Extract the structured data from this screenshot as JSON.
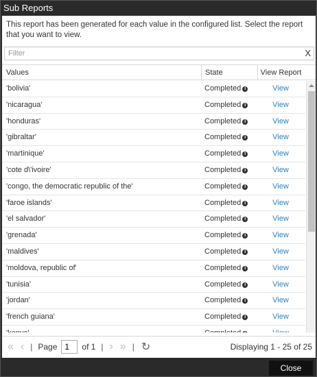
{
  "window": {
    "title": "Sub Reports"
  },
  "description": "This report has been generated for each value in the configured list. Select the report that you want to view.",
  "filter": {
    "placeholder": "Filter",
    "value": "",
    "clear_glyph": "X"
  },
  "table": {
    "headers": {
      "values": "Values",
      "state": "State",
      "view": "View Report"
    },
    "rows": [
      {
        "value": "'bolivia'",
        "state": "Completed",
        "action": "View"
      },
      {
        "value": "'nicaragua'",
        "state": "Completed",
        "action": "View"
      },
      {
        "value": "'honduras'",
        "state": "Completed",
        "action": "View"
      },
      {
        "value": "'gibraltar'",
        "state": "Completed",
        "action": "View"
      },
      {
        "value": "'martinique'",
        "state": "Completed",
        "action": "View"
      },
      {
        "value": "'cote d\\'ivoire'",
        "state": "Completed",
        "action": "View"
      },
      {
        "value": "'congo, the democratic republic of the'",
        "state": "Completed",
        "action": "View"
      },
      {
        "value": "'faroe islands'",
        "state": "Completed",
        "action": "View"
      },
      {
        "value": "'el salvador'",
        "state": "Completed",
        "action": "View"
      },
      {
        "value": "'grenada'",
        "state": "Completed",
        "action": "View"
      },
      {
        "value": "'maldives'",
        "state": "Completed",
        "action": "View"
      },
      {
        "value": "'moldova, republic of'",
        "state": "Completed",
        "action": "View"
      },
      {
        "value": "'tunisia'",
        "state": "Completed",
        "action": "View"
      },
      {
        "value": "'jordan'",
        "state": "Completed",
        "action": "View"
      },
      {
        "value": "'french guiana'",
        "state": "Completed",
        "action": "View"
      },
      {
        "value": "'kenya'",
        "state": "Completed",
        "action": "View"
      }
    ]
  },
  "pager": {
    "page_label": "Page",
    "page_value": "1",
    "of_label": "of 1",
    "displaying": "Displaying 1 - 25 of 25",
    "icons": [
      "first-page-icon",
      "prev-page-icon",
      "next-page-icon",
      "last-page-icon",
      "refresh-icon"
    ]
  },
  "footer": {
    "close_label": "Close"
  },
  "colors": {
    "link": "#2d7fc0",
    "titlebar": "#2a2a2a",
    "close_button": "#111111"
  }
}
